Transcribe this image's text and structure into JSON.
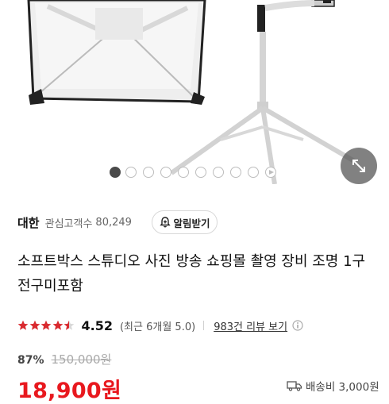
{
  "hero": {
    "image_description_icon": "softbox-product-photo",
    "slides_total": 10,
    "active_slide": 1
  },
  "shop": {
    "name": "대한",
    "fav_label": "관심고객수",
    "fav_count": "80,249",
    "alarm_label": "알림받기"
  },
  "product": {
    "title": "소프트박스 스튜디오 사진 방송 쇼핑몰 촬영 장비 조명 1구전구미포함"
  },
  "rating": {
    "score": "4.52",
    "stars_value": 4.5,
    "recent_text": "(최근 6개월 5.0)",
    "review_link": "983건 리뷰 보기"
  },
  "price": {
    "discount": "87%",
    "original": "150,000원",
    "sale": "18,900원",
    "shipping": "배송비 3,000원"
  },
  "colors": {
    "accent_red": "#e8181e",
    "star_red": "#d92a2f"
  }
}
